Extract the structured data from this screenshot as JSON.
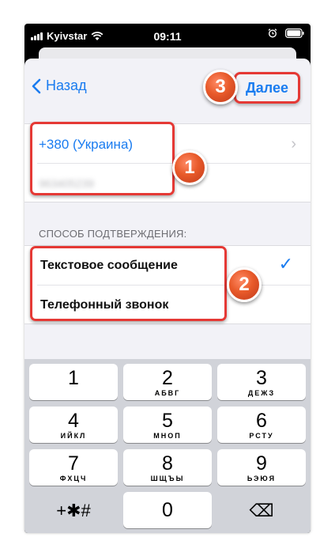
{
  "status_bar": {
    "carrier": "Kyivstar",
    "time": "09:11"
  },
  "nav": {
    "back_label": "Назад",
    "next_label": "Далее"
  },
  "phone_group": {
    "country": "+380 (Украина)",
    "phone_number": "963405239"
  },
  "method_section": {
    "header": "СПОСОБ ПОДТВЕРЖДЕНИЯ:",
    "options": [
      "Текстовое сообщение",
      "Телефонный звонок"
    ]
  },
  "annotations": {
    "badge1": "1",
    "badge2": "2",
    "badge3": "3"
  },
  "keypad": {
    "keys": [
      {
        "num": "1",
        "letters": ""
      },
      {
        "num": "2",
        "letters": "АБВГ"
      },
      {
        "num": "3",
        "letters": "ДЕЖЗ"
      },
      {
        "num": "4",
        "letters": "ИЙКЛ"
      },
      {
        "num": "5",
        "letters": "МНОП"
      },
      {
        "num": "6",
        "letters": "РСТУ"
      },
      {
        "num": "7",
        "letters": "ФХЦЧ"
      },
      {
        "num": "8",
        "letters": "ШЩЪЫ"
      },
      {
        "num": "9",
        "letters": "ЬЭЮЯ"
      },
      {
        "num": "+✱#",
        "letters": ""
      },
      {
        "num": "0",
        "letters": ""
      },
      {
        "num": "⌫",
        "letters": ""
      }
    ]
  },
  "colors": {
    "accent": "#1a7cf0",
    "highlight": "#e53935",
    "badge": "#e85a2a"
  }
}
